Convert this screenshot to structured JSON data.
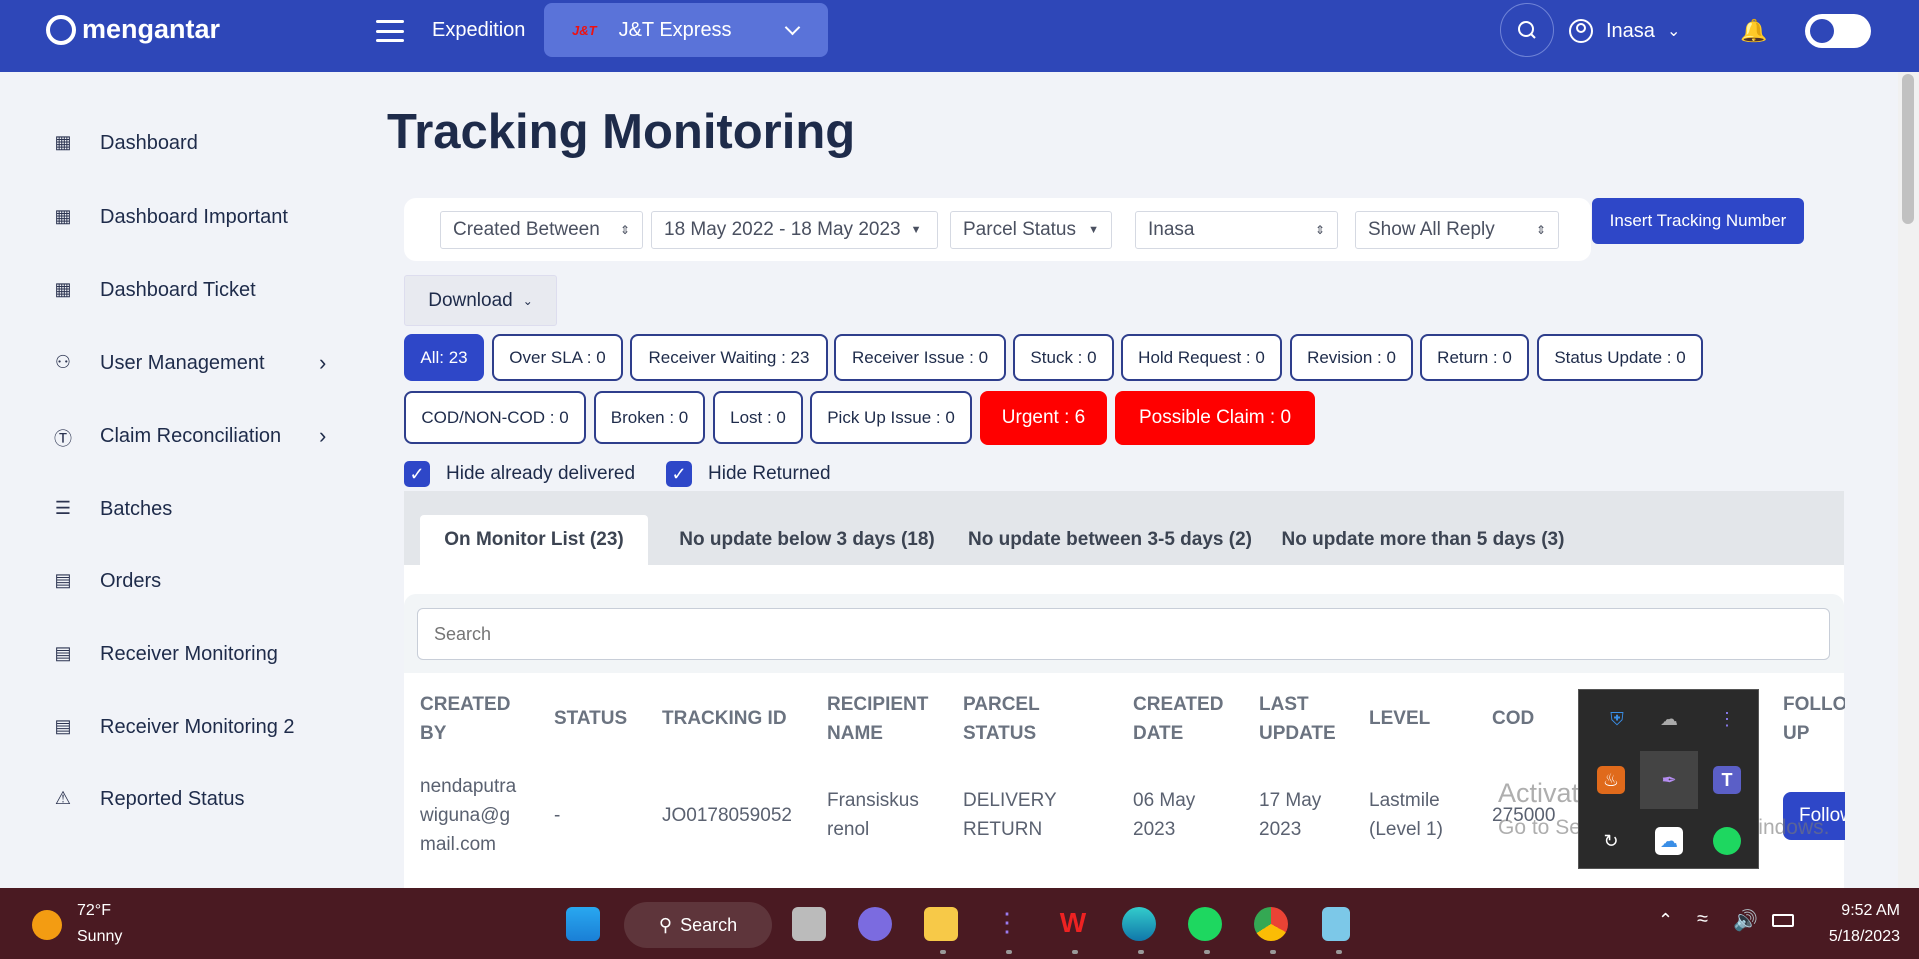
{
  "topbar": {
    "brand": "mengantar",
    "section": "Expedition",
    "courier_logo": "J&T",
    "courier": "J&T Express",
    "user": "Inasa",
    "icons": [
      "menu-icon",
      "search-icon",
      "user-icon",
      "chevron-down-icon",
      "bell-icon",
      "theme-toggle"
    ],
    "colors": {
      "bar": "#2e47b8",
      "accent": "#2e47c8",
      "urgent": "#ff0000"
    }
  },
  "sidebar": {
    "items": [
      {
        "label": "Dashboard",
        "icon": "grid-icon"
      },
      {
        "label": "Dashboard Important",
        "icon": "grid-icon"
      },
      {
        "label": "Dashboard Ticket",
        "icon": "grid-icon"
      },
      {
        "label": "User Management",
        "icon": "users-icon",
        "arrow": true
      },
      {
        "label": "Claim Reconciliation",
        "icon": "dollar-icon",
        "arrow": true
      },
      {
        "label": "Batches",
        "icon": "layers-icon"
      },
      {
        "label": "Orders",
        "icon": "list-icon"
      },
      {
        "label": "Receiver Monitoring",
        "icon": "list-icon"
      },
      {
        "label": "Receiver Monitoring 2",
        "icon": "list-icon"
      },
      {
        "label": "Reported Status",
        "icon": "alert-icon"
      }
    ]
  },
  "page": {
    "title": "Tracking Monitoring"
  },
  "filters": {
    "date_type": "Created Between",
    "date_range": "18 May 2022 - 18 May 2023",
    "parcel_status": "Parcel Status",
    "user": "Inasa",
    "reply": "Show All Reply",
    "insert_button": "Insert Tracking Number",
    "download": "Download"
  },
  "chips": [
    "All: 23",
    "Over SLA : 0",
    "Receiver Waiting : 23",
    "Receiver Issue : 0",
    "Stuck : 0",
    "Hold Request : 0",
    "Revision : 0",
    "Return : 0",
    "Status Update : 0",
    "COD/NON-COD : 0",
    "Broken : 0",
    "Lost : 0",
    "Pick Up Issue : 0",
    "Urgent : 6",
    "Possible Claim : 0"
  ],
  "checkboxes": [
    {
      "label": "Hide already delivered",
      "checked": true
    },
    {
      "label": "Hide Returned",
      "checked": true
    }
  ],
  "tabs": [
    "On Monitor List (23)",
    "No update below 3 days (18)",
    "No update between 3-5 days (2)",
    "No update more than 5 days (3)"
  ],
  "search": {
    "placeholder": "Search"
  },
  "table": {
    "headers": [
      [
        "CREATED",
        "BY"
      ],
      [
        "STATUS"
      ],
      [
        "TRACKING ID"
      ],
      [
        "RECIPIENT",
        "NAME"
      ],
      [
        "PARCEL",
        "STATUS"
      ],
      [
        "CREATED",
        "DATE"
      ],
      [
        "LAST",
        "UPDATE"
      ],
      [
        "LEVEL"
      ],
      [
        "COD"
      ],
      [
        "FOLLOW",
        "UP"
      ]
    ],
    "rows": [
      {
        "created_by": [
          "nendaputra",
          "wiguna@g",
          "mail.com"
        ],
        "status": "-",
        "tracking_id": "JO0178059052",
        "recipient": [
          "Fransiskus",
          "renol"
        ],
        "parcel_status": [
          "DELIVERY",
          "RETURN"
        ],
        "created_date": [
          "06 May",
          "2023"
        ],
        "last_update": [
          "17 May",
          "2023"
        ],
        "level": [
          "Lastmile",
          "(Level 1)"
        ],
        "cod": "275000",
        "follow": "Follow"
      }
    ]
  },
  "watermark": {
    "line1": "Activate Windows",
    "line2": "Go to Settings to activate Windows."
  },
  "tray_icons": [
    "defender-warning-icon",
    "onedrive-off-icon",
    "podcast-icon",
    "java-icon",
    "feather-icon",
    "teams-icon",
    "sync-icon",
    "cloud-icon",
    "spotify-icon"
  ],
  "taskbar": {
    "temp": "72°F",
    "weather": "Sunny",
    "search": "Search",
    "time": "9:52 AM",
    "date": "5/18/2023",
    "apps": [
      "windows-start-icon",
      "task-view-icon",
      "meet-icon",
      "file-explorer-icon",
      "voice-icon",
      "wps-icon",
      "edge-icon",
      "spotify-icon",
      "chrome-icon",
      "notepad-icon"
    ]
  }
}
